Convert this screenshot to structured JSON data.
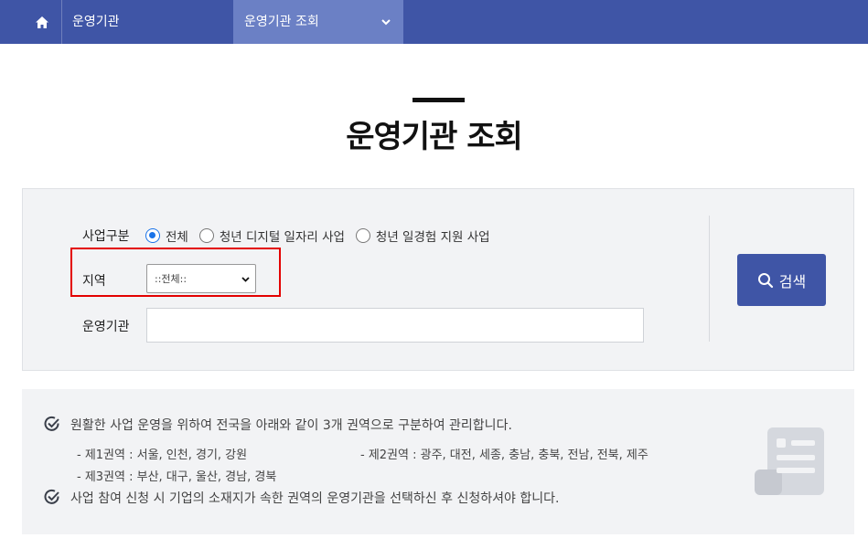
{
  "nav": {
    "home_icon": "home-icon",
    "crumb": "운영기관",
    "dropdown": "운영기관 조회",
    "dropdown_icon": "chevron-down-icon"
  },
  "page": {
    "title": "운영기관 조회"
  },
  "search": {
    "business_type_label": "사업구분",
    "business_options": [
      "전체",
      "청년 디지털 일자리 사업",
      "청년 일경험 지원 사업"
    ],
    "business_selected": "전체",
    "region_label": "지역",
    "region_value": "::전체::",
    "org_label": "운영기관",
    "org_value": "",
    "search_button": "검색"
  },
  "info": {
    "line1": "원활한 사업 운영을 위하여 전국을 아래와 같이 3개 권역으로 구분하여 관리합니다.",
    "region1": "- 제1권역 : 서울, 인천, 경기, 강원",
    "region2": "- 제2권역 : 광주, 대전, 세종, 충남, 충북, 전남, 전북, 제주",
    "region3": "- 제3권역 : 부산, 대구, 울산, 경남, 경북",
    "line2": "사업 참여 신청 시 기업의 소재지가 속한 권역의 운영기관을 선택하신 후 신청하셔야 합니다."
  },
  "colors": {
    "brand": "#3f55a6",
    "highlight": "#e30000",
    "panel": "#f2f3f5"
  }
}
